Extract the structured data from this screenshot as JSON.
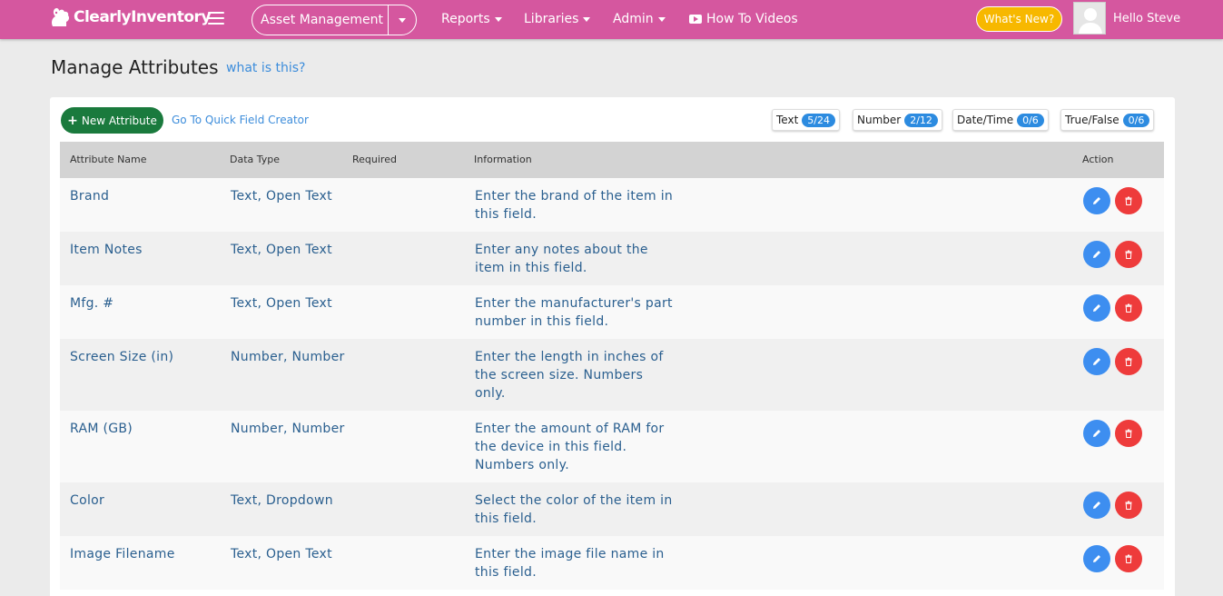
{
  "header": {
    "logo_text": "ClearlyInventory",
    "asset_button": "Asset Management",
    "nav": [
      {
        "label": "Reports"
      },
      {
        "label": "Libraries"
      },
      {
        "label": "Admin"
      },
      {
        "label": "How To Videos"
      }
    ],
    "whats_new": "What's New?",
    "greeting": "Hello Steve"
  },
  "page": {
    "title": "Manage Attributes",
    "help_link": "what is this?"
  },
  "toolbar": {
    "new_attribute": "New Attribute",
    "quick_field": "Go To Quick Field Creator"
  },
  "counters": [
    {
      "label": "Text",
      "value": "5/24"
    },
    {
      "label": "Number",
      "value": "2/12"
    },
    {
      "label": "Date/Time",
      "value": "0/6"
    },
    {
      "label": "True/False",
      "value": "0/6"
    }
  ],
  "table": {
    "columns": [
      "Attribute Name",
      "Data Type",
      "Required",
      "Information",
      "Action"
    ],
    "rows": [
      {
        "name": "Brand",
        "type": "Text, Open Text",
        "required": "",
        "info": "Enter the brand of the item in this field."
      },
      {
        "name": "Item Notes",
        "type": "Text, Open Text",
        "required": "",
        "info": "Enter any notes about the item in this field."
      },
      {
        "name": "Mfg. #",
        "type": "Text, Open Text",
        "required": "",
        "info": "Enter the manufacturer's part number in this field."
      },
      {
        "name": "Screen Size (in)",
        "type": "Number, Number",
        "required": "",
        "info": "Enter the length in inches of the screen size. Numbers only."
      },
      {
        "name": "RAM (GB)",
        "type": "Number, Number",
        "required": "",
        "info": "Enter the amount of RAM for the device in this field. Numbers only."
      },
      {
        "name": "Color",
        "type": "Text, Dropdown",
        "required": "",
        "info": "Select the color of the item in this field."
      },
      {
        "name": "Image Filename",
        "type": "Text, Open Text",
        "required": "",
        "info": "Enter the image file name in this field."
      }
    ]
  },
  "colors": {
    "brand": "#d5579f",
    "new_button": "#1a7a3d",
    "edit": "#3d8ef0",
    "delete": "#ee3b3b",
    "whats_new": "#f7b800"
  }
}
